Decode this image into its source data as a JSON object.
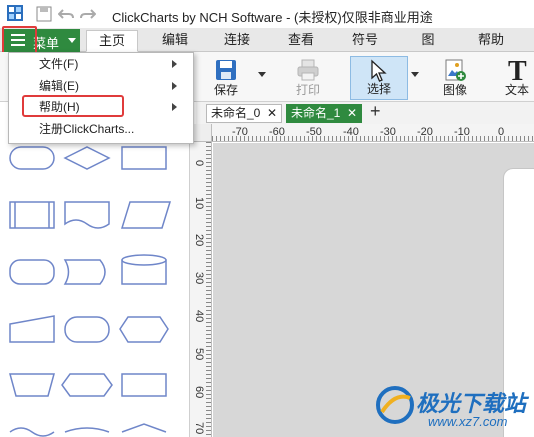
{
  "window": {
    "title": "ClickCharts by NCH Software - (未授权)仅限非商业用途"
  },
  "ribbon": {
    "menu_label": "菜单",
    "tabs": [
      {
        "label": "主页",
        "active": true
      },
      {
        "label": "编辑"
      },
      {
        "label": "连接"
      },
      {
        "label": "查看"
      },
      {
        "label": "符号"
      },
      {
        "label": "图"
      },
      {
        "label": "帮助"
      }
    ]
  },
  "toolbar": {
    "save": "保存",
    "print": "打印",
    "select": "选择",
    "image": "图像",
    "text": "文本"
  },
  "dropdown": {
    "items": [
      {
        "label": "文件(F)",
        "submenu": true
      },
      {
        "label": "编辑(E)",
        "submenu": true
      },
      {
        "label": "帮助(H)",
        "submenu": true
      },
      {
        "label": "注册ClickCharts...",
        "submenu": false
      }
    ]
  },
  "doc_tabs": [
    {
      "label": "未命名_0",
      "close": "✕"
    },
    {
      "label": "未命名_1",
      "close": "✕",
      "active": true
    }
  ],
  "add_tab": "+",
  "ruler": {
    "horizontal": [
      "-70",
      "-60",
      "-50",
      "-40",
      "-30",
      "-20",
      "-10",
      "0"
    ],
    "vertical": [
      "0",
      "10",
      "20",
      "30",
      "40",
      "50",
      "60",
      "70"
    ]
  },
  "watermark": {
    "name": "极光下载站",
    "url": "www.xz7.com"
  },
  "colors": {
    "accent_green": "#2f8a3f",
    "highlight_red": "#e03b3b",
    "shape_stroke": "#6f86c9"
  }
}
